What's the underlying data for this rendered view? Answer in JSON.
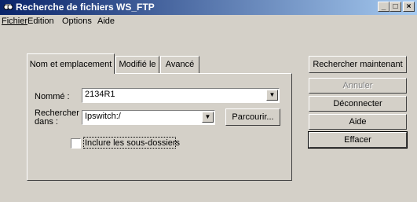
{
  "window": {
    "title": "Recherche de fichiers WS_FTP",
    "controls": {
      "minimize": "_",
      "maximize": "□",
      "close": "×"
    }
  },
  "menu": {
    "fichier": "Fichier",
    "edition": "Edition",
    "options": "Options",
    "aide": "Aide"
  },
  "tabs": [
    {
      "label": "Nom et emplacement",
      "active": true
    },
    {
      "label": "Modifié le",
      "active": false
    },
    {
      "label": "Avancé",
      "active": false
    }
  ],
  "form": {
    "nomme_label": "Nommé :",
    "nomme_value": "2134R1",
    "rechercher_label_1": "Rechercher",
    "rechercher_label_2": "dans :",
    "rechercher_value": "Ipswitch:/",
    "parcourir_label": "Parcourir...",
    "checkbox_label": "Inclure les sous-dossiers",
    "checkbox_checked": false
  },
  "actions": {
    "rechercher": "Rechercher maintenant",
    "annuler": "Annuler",
    "deconnecter": "Déconnecter",
    "aide": "Aide",
    "effacer": "Effacer"
  }
}
